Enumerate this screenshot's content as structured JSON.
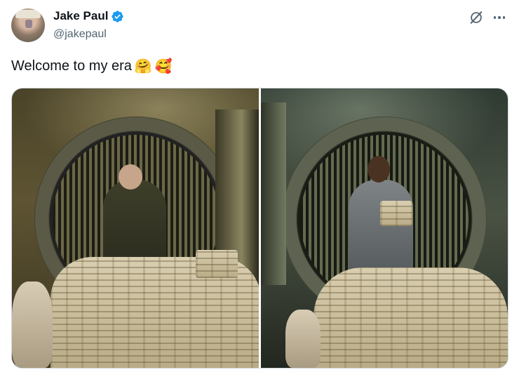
{
  "author": {
    "display_name": "Jake Paul",
    "handle": "@jakepaul",
    "verified": true,
    "verified_color": "#1d9bf0"
  },
  "header_actions": {
    "grok_icon": "grok-slash-icon",
    "more_icon": "more-dots-icon"
  },
  "post": {
    "text": "Welcome to my era",
    "emojis": [
      "🤗",
      "🥰"
    ]
  },
  "media": {
    "count": 2,
    "images": [
      {
        "subject": "bank-vault-photo-jake-paul",
        "icon": "image-icon"
      },
      {
        "subject": "bank-vault-photo-muhammad-ali",
        "icon": "image-icon"
      }
    ]
  },
  "colors": {
    "text_primary": "#0f1419",
    "text_secondary": "#536471",
    "border": "#cfd9de"
  }
}
